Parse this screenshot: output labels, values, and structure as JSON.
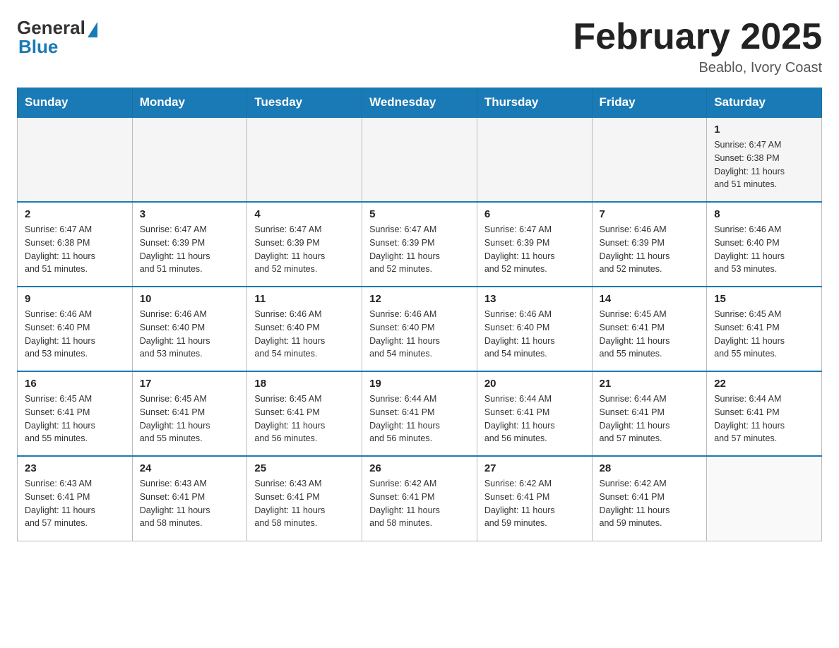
{
  "logo": {
    "general": "General",
    "blue": "Blue"
  },
  "title": "February 2025",
  "location": "Beablo, Ivory Coast",
  "days_of_week": [
    "Sunday",
    "Monday",
    "Tuesday",
    "Wednesday",
    "Thursday",
    "Friday",
    "Saturday"
  ],
  "weeks": [
    [
      {
        "day": "",
        "info": ""
      },
      {
        "day": "",
        "info": ""
      },
      {
        "day": "",
        "info": ""
      },
      {
        "day": "",
        "info": ""
      },
      {
        "day": "",
        "info": ""
      },
      {
        "day": "",
        "info": ""
      },
      {
        "day": "1",
        "info": "Sunrise: 6:47 AM\nSunset: 6:38 PM\nDaylight: 11 hours\nand 51 minutes."
      }
    ],
    [
      {
        "day": "2",
        "info": "Sunrise: 6:47 AM\nSunset: 6:38 PM\nDaylight: 11 hours\nand 51 minutes."
      },
      {
        "day": "3",
        "info": "Sunrise: 6:47 AM\nSunset: 6:39 PM\nDaylight: 11 hours\nand 51 minutes."
      },
      {
        "day": "4",
        "info": "Sunrise: 6:47 AM\nSunset: 6:39 PM\nDaylight: 11 hours\nand 52 minutes."
      },
      {
        "day": "5",
        "info": "Sunrise: 6:47 AM\nSunset: 6:39 PM\nDaylight: 11 hours\nand 52 minutes."
      },
      {
        "day": "6",
        "info": "Sunrise: 6:47 AM\nSunset: 6:39 PM\nDaylight: 11 hours\nand 52 minutes."
      },
      {
        "day": "7",
        "info": "Sunrise: 6:46 AM\nSunset: 6:39 PM\nDaylight: 11 hours\nand 52 minutes."
      },
      {
        "day": "8",
        "info": "Sunrise: 6:46 AM\nSunset: 6:40 PM\nDaylight: 11 hours\nand 53 minutes."
      }
    ],
    [
      {
        "day": "9",
        "info": "Sunrise: 6:46 AM\nSunset: 6:40 PM\nDaylight: 11 hours\nand 53 minutes."
      },
      {
        "day": "10",
        "info": "Sunrise: 6:46 AM\nSunset: 6:40 PM\nDaylight: 11 hours\nand 53 minutes."
      },
      {
        "day": "11",
        "info": "Sunrise: 6:46 AM\nSunset: 6:40 PM\nDaylight: 11 hours\nand 54 minutes."
      },
      {
        "day": "12",
        "info": "Sunrise: 6:46 AM\nSunset: 6:40 PM\nDaylight: 11 hours\nand 54 minutes."
      },
      {
        "day": "13",
        "info": "Sunrise: 6:46 AM\nSunset: 6:40 PM\nDaylight: 11 hours\nand 54 minutes."
      },
      {
        "day": "14",
        "info": "Sunrise: 6:45 AM\nSunset: 6:41 PM\nDaylight: 11 hours\nand 55 minutes."
      },
      {
        "day": "15",
        "info": "Sunrise: 6:45 AM\nSunset: 6:41 PM\nDaylight: 11 hours\nand 55 minutes."
      }
    ],
    [
      {
        "day": "16",
        "info": "Sunrise: 6:45 AM\nSunset: 6:41 PM\nDaylight: 11 hours\nand 55 minutes."
      },
      {
        "day": "17",
        "info": "Sunrise: 6:45 AM\nSunset: 6:41 PM\nDaylight: 11 hours\nand 55 minutes."
      },
      {
        "day": "18",
        "info": "Sunrise: 6:45 AM\nSunset: 6:41 PM\nDaylight: 11 hours\nand 56 minutes."
      },
      {
        "day": "19",
        "info": "Sunrise: 6:44 AM\nSunset: 6:41 PM\nDaylight: 11 hours\nand 56 minutes."
      },
      {
        "day": "20",
        "info": "Sunrise: 6:44 AM\nSunset: 6:41 PM\nDaylight: 11 hours\nand 56 minutes."
      },
      {
        "day": "21",
        "info": "Sunrise: 6:44 AM\nSunset: 6:41 PM\nDaylight: 11 hours\nand 57 minutes."
      },
      {
        "day": "22",
        "info": "Sunrise: 6:44 AM\nSunset: 6:41 PM\nDaylight: 11 hours\nand 57 minutes."
      }
    ],
    [
      {
        "day": "23",
        "info": "Sunrise: 6:43 AM\nSunset: 6:41 PM\nDaylight: 11 hours\nand 57 minutes."
      },
      {
        "day": "24",
        "info": "Sunrise: 6:43 AM\nSunset: 6:41 PM\nDaylight: 11 hours\nand 58 minutes."
      },
      {
        "day": "25",
        "info": "Sunrise: 6:43 AM\nSunset: 6:41 PM\nDaylight: 11 hours\nand 58 minutes."
      },
      {
        "day": "26",
        "info": "Sunrise: 6:42 AM\nSunset: 6:41 PM\nDaylight: 11 hours\nand 58 minutes."
      },
      {
        "day": "27",
        "info": "Sunrise: 6:42 AM\nSunset: 6:41 PM\nDaylight: 11 hours\nand 59 minutes."
      },
      {
        "day": "28",
        "info": "Sunrise: 6:42 AM\nSunset: 6:41 PM\nDaylight: 11 hours\nand 59 minutes."
      },
      {
        "day": "",
        "info": ""
      }
    ]
  ]
}
